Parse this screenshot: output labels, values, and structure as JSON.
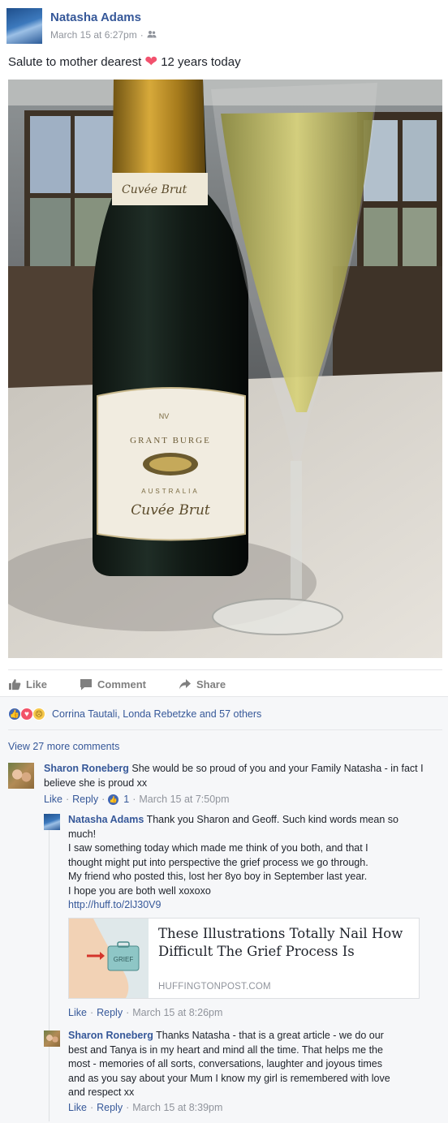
{
  "post": {
    "author": "Natasha Adams",
    "timestamp": "March 15 at 6:27pm",
    "audience_icon": "friends-icon",
    "text_before": "Salute to mother dearest",
    "text_after": "12 years today",
    "photo_label_nv": "NV",
    "photo_label_brand": "GRANT BURGE",
    "photo_label_country": "AUSTRALIA",
    "photo_label_style": "Cuvée Brut",
    "photo_label_neck": "Cuvée Brut"
  },
  "actions": {
    "like": "Like",
    "comment": "Comment",
    "share": "Share"
  },
  "reactions": {
    "summary": "Corrina Tautali, Londa Rebetzke and 57 others",
    "types": [
      "like",
      "love",
      "sad"
    ]
  },
  "view_more": "View 27 more comments",
  "comments": [
    {
      "author": "Sharon Roneberg",
      "text": "She would be so proud of you and your Family Natasha - in fact I believe she is proud xx",
      "like": "Like",
      "reply": "Reply",
      "likes_count": "1",
      "timestamp": "March 15 at 7:50pm"
    }
  ],
  "replies": [
    {
      "author": "Natasha Adams",
      "lines": [
        "Thank you Sharon and Geoff. Such kind words mean so",
        "much!",
        "I saw something today which made me think of you both, and that I",
        "thought might put into perspective the grief process we go through.",
        "My friend who posted this, lost her 8yo boy in September last year.",
        "I hope you are both well xoxoxo"
      ],
      "link": "http://huff.to/2lJ30V9",
      "like": "Like",
      "reply": "Reply",
      "timestamp": "March 15 at 8:26pm"
    },
    {
      "author": "Sharon Roneberg",
      "lines": [
        "Thanks Natasha - that is a great article - we do our",
        "best and Tanya is in my heart and mind all the time. That helps me the",
        "most - memories of all sorts, conversations, laughter and joyous times",
        "and as you say about your Mum I know my girl is remembered with love",
        "and respect xx"
      ],
      "like": "Like",
      "reply": "Reply",
      "timestamp": "March 15 at 8:39pm"
    }
  ],
  "link_card": {
    "title": "These Illustrations Totally Nail How Difficult The Grief Process Is",
    "domain": "HUFFINGTONPOST.COM",
    "thumb_label": "GRIEF"
  }
}
